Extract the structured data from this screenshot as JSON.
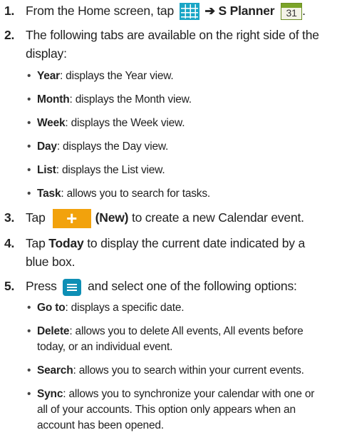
{
  "steps": [
    {
      "num": "1.",
      "text_a": "From the Home screen, tap",
      "arrow": "➔",
      "app_name": "S Planner",
      "planner_icon_date": "31",
      "text_end": "."
    },
    {
      "num": "2.",
      "text": "The following tabs are available on the right side of the display:",
      "bullets": [
        {
          "term": "Year",
          "desc": ": displays the Year view."
        },
        {
          "term": "Month",
          "desc": ": displays the Month view."
        },
        {
          "term": "Week",
          "desc": ": displays the Week view."
        },
        {
          "term": "Day",
          "desc": ": displays the Day view."
        },
        {
          "term": "List",
          "desc": ": displays the List view."
        },
        {
          "term": "Task",
          "desc": ": allows you to search for tasks."
        }
      ]
    },
    {
      "num": "3.",
      "text_a": "Tap",
      "new_label": "(New)",
      "text_b": "to create a new Calendar event."
    },
    {
      "num": "4.",
      "text_a": "Tap",
      "today_label": "Today",
      "text_b": "to display the current date indicated by a blue box."
    },
    {
      "num": "5.",
      "text_a": "Press",
      "text_b": "and select one of the following options:",
      "bullets": [
        {
          "term": "Go to",
          "desc": ": displays a specific date."
        },
        {
          "term": "Delete",
          "desc": ": allows you to delete All events, All events before today, or an individual event."
        },
        {
          "term": "Search",
          "desc": ": allows you to search within your current events."
        },
        {
          "term": "Sync",
          "desc": ": allows you to synchronize your calendar with one or all of your accounts. This option only appears when an account has been opened."
        }
      ]
    }
  ],
  "icons": {
    "apps": "apps-grid-icon",
    "planner": "calendar-icon",
    "new": "plus-icon",
    "menu": "menu-icon"
  },
  "colors": {
    "apps_icon": "#1aa6c6",
    "plus_icon": "#f2a20c",
    "menu_icon": "#0e8fb5",
    "planner_header": "#7ba428"
  }
}
